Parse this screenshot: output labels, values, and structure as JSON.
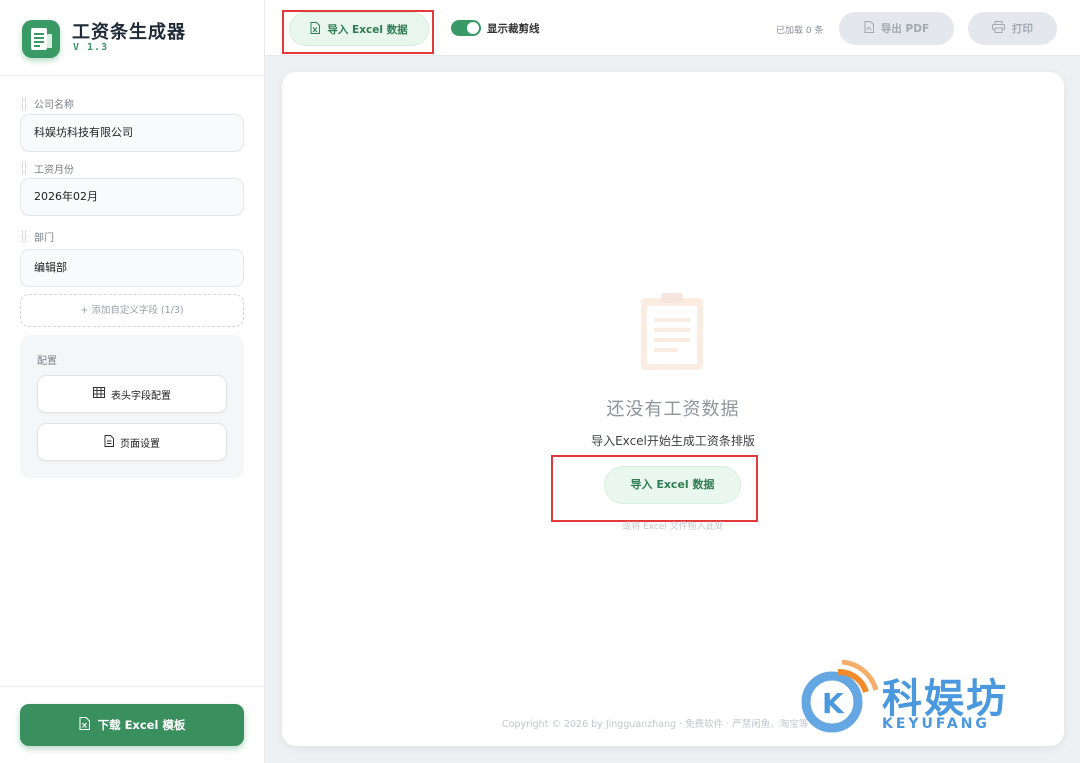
{
  "app": {
    "title": "工资条生成器",
    "version": "V 1.3"
  },
  "sidebar": {
    "fields": [
      {
        "label": "公司名称",
        "value": "科娱坊科技有限公司"
      },
      {
        "label": "工资月份",
        "value": "2026年02月"
      },
      {
        "label": "部门",
        "value": "编辑部"
      }
    ],
    "add_field_label": "+ 添加自定义字段 (1/3)",
    "config": {
      "title": "配置",
      "header_config_label": "表头字段配置",
      "page_settings_label": "页面设置"
    },
    "download_label": "下载 Excel 模板"
  },
  "toolbar": {
    "import_label": "导入 Excel 数据",
    "crop_lines_label": "显示裁剪线",
    "crop_lines_on": true,
    "loaded_count": "已加载 0 条",
    "export_pdf_label": "导出 PDF",
    "print_label": "打印"
  },
  "main": {
    "empty_title": "还没有工资数据",
    "empty_subtitle": "导入Excel开始生成工资条排版",
    "import_label": "导入 Excel 数据",
    "drop_hint": "或将 Excel 文件拖入此处",
    "footer": "Copyright © 2026 by Jingguanzhang · 免费软件 · 严禁闲鱼、淘宝等"
  },
  "watermark": {
    "text": "科娱坊",
    "subtext": "KEYUFANG"
  },
  "colors": {
    "accent": "#3a9a66",
    "highlight_box": "#e23a3a",
    "watermark": "#4a98de"
  }
}
